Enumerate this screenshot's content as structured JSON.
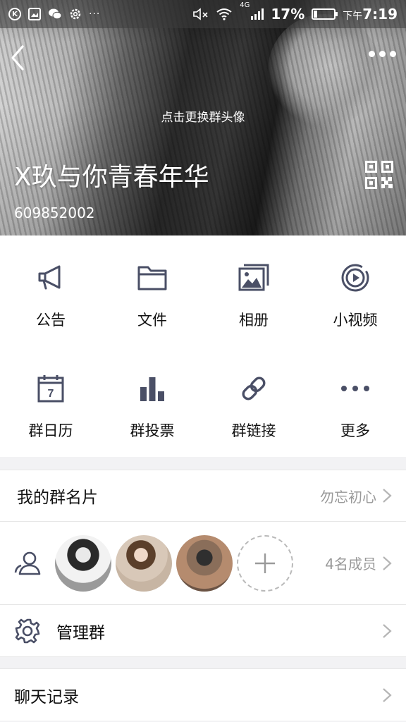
{
  "status_bar": {
    "battery_percent": "17%",
    "time_prefix": "下午",
    "time": "7:19",
    "network": "4G",
    "left_icons": [
      "k-app-icon",
      "image-icon",
      "wechat-icon",
      "settings-icon",
      "more-dots-icon"
    ]
  },
  "header": {
    "avatar_hint": "点击更换群头像",
    "group_name": "X玖与你青春年华",
    "group_id": "609852002"
  },
  "features": [
    {
      "label": "公告",
      "icon": "megaphone-icon"
    },
    {
      "label": "文件",
      "icon": "folder-icon"
    },
    {
      "label": "相册",
      "icon": "album-icon"
    },
    {
      "label": "小视频",
      "icon": "video-icon"
    },
    {
      "label": "群日历",
      "icon": "calendar-icon"
    },
    {
      "label": "群投票",
      "icon": "poll-icon"
    },
    {
      "label": "群链接",
      "icon": "link-icon"
    },
    {
      "label": "更多",
      "icon": "more-icon"
    }
  ],
  "calendar_day": "7",
  "card_row": {
    "title": "我的群名片",
    "value": "勿忘初心"
  },
  "members_row": {
    "count": "4名成员"
  },
  "manage_row": {
    "title": "管理群"
  },
  "chat_row": {
    "title": "聊天记录"
  },
  "colors": {
    "icon": "#4a4f66",
    "muted": "#999999",
    "accent": "#ffffff"
  }
}
